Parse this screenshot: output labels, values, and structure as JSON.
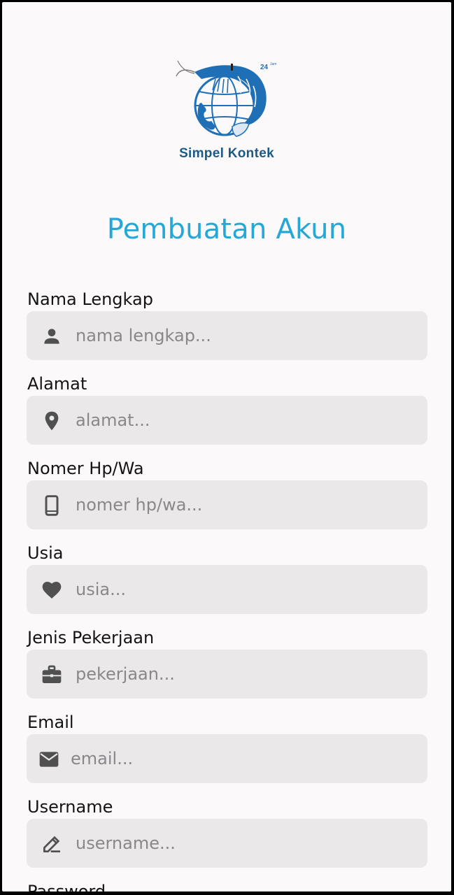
{
  "brand": {
    "name": "Simpel Kontek",
    "badge": "24",
    "badge_sub": "Jam"
  },
  "page_title": "Pembuatan Akun",
  "fields": [
    {
      "label": "Nama Lengkap",
      "placeholder": "nama lengkap...",
      "icon": "person-icon"
    },
    {
      "label": "Alamat",
      "placeholder": "alamat...",
      "icon": "location-pin-icon"
    },
    {
      "label": "Nomer Hp/Wa",
      "placeholder": "nomer hp/wa...",
      "icon": "phone-icon"
    },
    {
      "label": "Usia",
      "placeholder": "usia...",
      "icon": "heart-icon"
    },
    {
      "label": "Jenis Pekerjaan",
      "placeholder": "pekerjaan...",
      "icon": "briefcase-icon"
    },
    {
      "label": "Email",
      "placeholder": "email...",
      "icon": "mail-icon"
    },
    {
      "label": "Username",
      "placeholder": "username...",
      "icon": "pencil-icon"
    }
  ],
  "next_label_partial": "Password",
  "colors": {
    "title": "#27a7d6",
    "brand": "#1b5a87",
    "field_bg": "#ebe8ea",
    "icon": "#505050",
    "background": "#fcf9fb"
  }
}
